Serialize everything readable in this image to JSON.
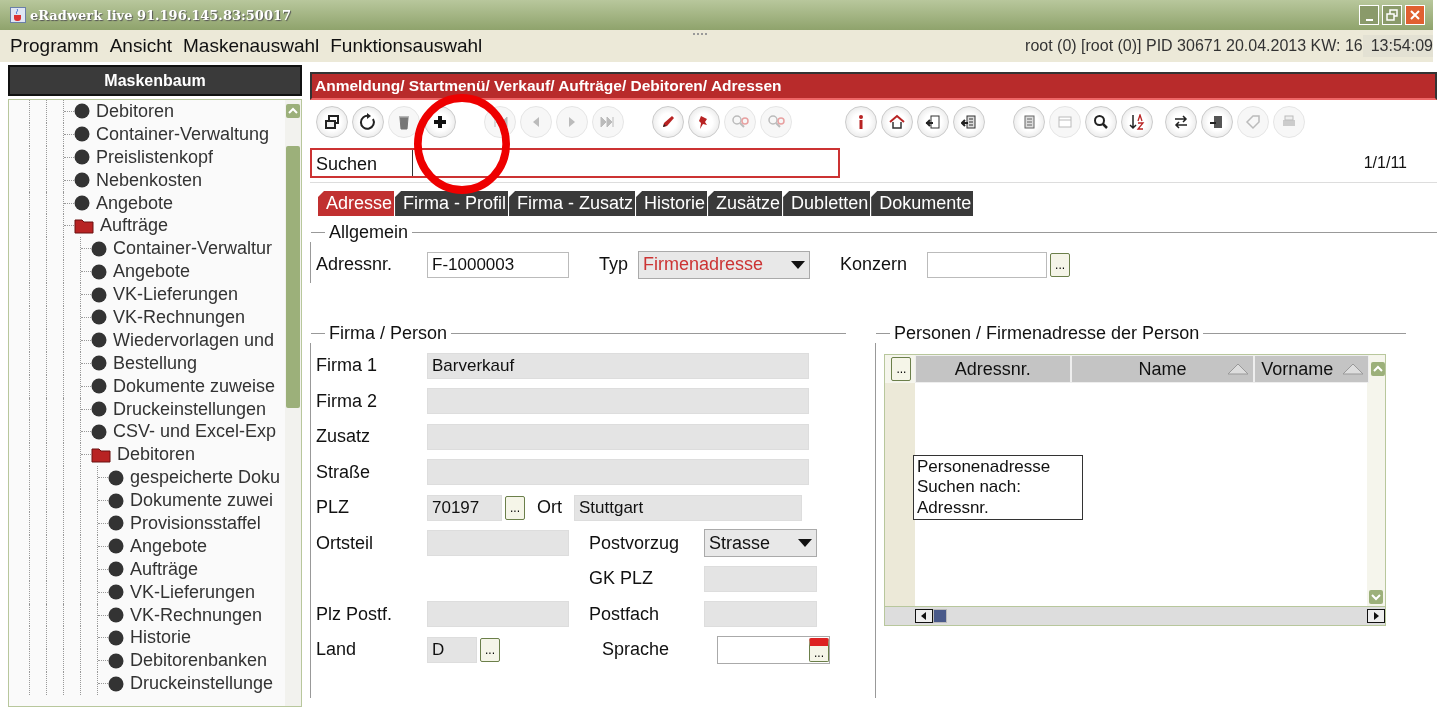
{
  "window": {
    "title": "eRadwerk live 91.196.145.83:50017"
  },
  "menu": [
    "Programm",
    "Ansicht",
    "Maskenauswahl",
    "Funktionsauswahl"
  ],
  "status": {
    "info": "root (0) [root (0)] PID 30671 20.04.2013 KW: 16",
    "time": "13:54:09"
  },
  "sidebar": {
    "title": "Maskenbaum",
    "tree": [
      {
        "label": "Debitoren"
      },
      {
        "label": "Container-Verwaltung"
      },
      {
        "label": "Preislistenkopf"
      },
      {
        "label": "Nebenkosten"
      },
      {
        "label": "Angebote"
      },
      {
        "label": "Aufträge",
        "children": [
          {
            "label": "Container-Verwaltur"
          },
          {
            "label": "Angebote"
          },
          {
            "label": "VK-Lieferungen"
          },
          {
            "label": "VK-Rechnungen"
          },
          {
            "label": "Wiedervorlagen und"
          },
          {
            "label": "Bestellung"
          },
          {
            "label": "Dokumente zuweise"
          },
          {
            "label": "Druckeinstellungen"
          },
          {
            "label": "CSV- und Excel-Exp"
          },
          {
            "label": "Debitoren",
            "children": [
              {
                "label": "gespeicherte Doku"
              },
              {
                "label": "Dokumente zuwei"
              },
              {
                "label": "Provisionsstaffel"
              },
              {
                "label": "Angebote"
              },
              {
                "label": "Aufträge"
              },
              {
                "label": "VK-Lieferungen"
              },
              {
                "label": "VK-Rechnungen"
              },
              {
                "label": "Historie"
              },
              {
                "label": "Debitorenbanken"
              },
              {
                "label": "Druckeinstellunge"
              }
            ]
          }
        ]
      }
    ]
  },
  "breadcrumb": "Anmeldung/ Startmenü/ Verkauf/ Aufträge/ Debitoren/ Adressen",
  "toolbar": [
    [
      {
        "kind": "windows",
        "disabled": false
      },
      {
        "kind": "refresh",
        "disabled": false
      },
      {
        "kind": "trash",
        "disabled": true
      },
      {
        "kind": "plus",
        "disabled": false
      }
    ],
    [
      {
        "kind": "first",
        "disabled": true
      },
      {
        "kind": "prev",
        "disabled": true
      },
      {
        "kind": "next",
        "disabled": true
      },
      {
        "kind": "last",
        "disabled": true
      }
    ],
    [
      {
        "kind": "pen",
        "disabled": false
      },
      {
        "kind": "pin",
        "disabled": false
      },
      {
        "kind": "find",
        "disabled": true
      },
      {
        "kind": "find",
        "disabled": true
      }
    ],
    [
      {
        "kind": "info",
        "disabled": false
      },
      {
        "kind": "home",
        "disabled": false
      },
      {
        "kind": "enter",
        "disabled": false
      },
      {
        "kind": "export",
        "disabled": false
      }
    ],
    [
      {
        "kind": "list",
        "disabled": false
      },
      {
        "kind": "window",
        "disabled": true
      },
      {
        "kind": "search",
        "disabled": false
      },
      {
        "kind": "sort",
        "disabled": false
      }
    ],
    [
      {
        "kind": "swap",
        "disabled": false
      },
      {
        "kind": "exit",
        "disabled": false
      },
      {
        "kind": "tag",
        "disabled": true
      },
      {
        "kind": "print",
        "disabled": true
      }
    ]
  ],
  "search": {
    "label": "Suchen"
  },
  "record_counter": "1/1/11",
  "tabs": [
    {
      "label": "Adresse",
      "selected": true
    },
    {
      "label": "Firma - Profil",
      "selected": false
    },
    {
      "label": "Firma - Zusatz",
      "selected": false
    },
    {
      "label": "Historie",
      "selected": false
    },
    {
      "label": "Zusätze",
      "selected": false
    },
    {
      "label": "Dubletten",
      "selected": false
    },
    {
      "label": "Dokumente",
      "selected": false
    }
  ],
  "general": {
    "title": "Allgemein",
    "address_no": {
      "label": "Adressnr.",
      "value": "F-1000003",
      "disabled": false
    },
    "type": {
      "label": "Typ",
      "value": "Firmenadresse"
    },
    "group": {
      "label": "Konzern",
      "disabled": false,
      "button": "..."
    }
  },
  "company": {
    "title": "Firma / Person",
    "fields": [
      {
        "label": "Firma 1",
        "value": "Barverkauf",
        "disabled": true
      },
      {
        "label": "Firma 2",
        "disabled": true
      },
      {
        "label": "Zusatz",
        "disabled": true
      },
      {
        "label": "Straße",
        "disabled": true
      }
    ],
    "zip": {
      "label": "PLZ",
      "value": "70197",
      "disabled": true,
      "button": "..."
    },
    "city": {
      "label": "Ort",
      "value": "Stuttgart",
      "disabled": true
    },
    "district": {
      "label": "Ortsteil",
      "disabled": true
    },
    "delivery": {
      "label": "Postvorzug",
      "value": "Strasse"
    },
    "gk_zip": {
      "label": "GK PLZ",
      "disabled": true
    },
    "po_zip": {
      "label": "Plz Postf.",
      "disabled": true
    },
    "po_box": {
      "label": "Postfach",
      "disabled": true
    },
    "country": {
      "label": "Land",
      "value": "D",
      "disabled": true,
      "button": "..."
    },
    "language": {
      "label": "Sprache",
      "button": "..."
    }
  },
  "persons": {
    "title": "Personen / Firmenadresse der Person",
    "button": "...",
    "columns": [
      {
        "label": "Adressnr.",
        "sortable": false
      },
      {
        "label": "Name",
        "sortable": true
      },
      {
        "label": "Vorname",
        "sortable": true
      }
    ],
    "tooltip": "Personenadresse\nSuchen nach:\nAdressnr."
  }
}
